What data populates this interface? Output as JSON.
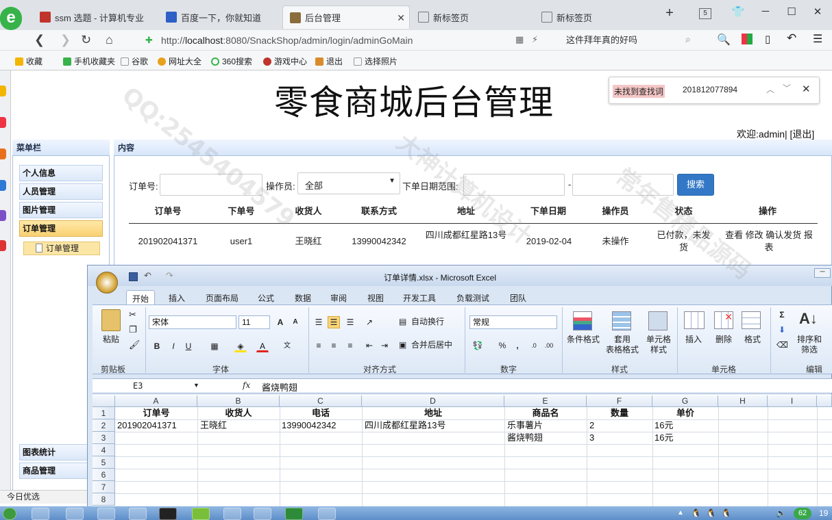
{
  "browser": {
    "tabs": [
      {
        "label": "ssm 选题 - 计算机专业",
        "color": "#c0342c"
      },
      {
        "label": "百度一下，你就知道",
        "color": "#2d5fc6"
      },
      {
        "label": "后台管理",
        "color": "#8a6d3b"
      },
      {
        "label": "新标签页",
        "color": "#777"
      },
      {
        "label": "新标签页",
        "color": "#777"
      }
    ],
    "tab_count": "5",
    "url_prefix": "http://",
    "url_domain": "localhost",
    "url_rest": ":8080/SnackShop/admin/login/adminGoMain",
    "search_text": "这件拜年真的好吗",
    "favorites": [
      "收藏",
      "手机收藏夹",
      "谷歌",
      "网址大全",
      "360搜索",
      "游戏中心",
      "退出",
      "选择照片"
    ]
  },
  "find": {
    "status": "未找到查找词",
    "query": "201812077894"
  },
  "page": {
    "title": "零食商城后台管理",
    "welcome": "欢迎:admin| [退出]",
    "menu_header": "菜单栏",
    "content_header": "内容",
    "menu": [
      "个人信息",
      "人员管理",
      "图片管理",
      "订单管理"
    ],
    "submenu": "订单管理",
    "menu_bottom": [
      "图表统计",
      "商品管理"
    ],
    "today": "今日优选"
  },
  "search_form": {
    "order_label": "订单号:",
    "operator_label": "操作员:",
    "operator_value": "全部",
    "date_label": "下单日期范围:",
    "date_sep": "-",
    "search_btn": "搜索"
  },
  "orders": {
    "headers": [
      "订单号",
      "下单号",
      "收货人",
      "联系方式",
      "地址",
      "下单日期",
      "操作员",
      "状态",
      "操作"
    ],
    "rows": [
      {
        "order_no": "201902041371",
        "user": "user1",
        "receiver": "王晓红",
        "phone": "13990042342",
        "address": "四川成都红星路13号",
        "date": "2019-02-04",
        "operator": "未操作",
        "status": "已付款，未发货",
        "actions": "查看 修改 确认发货 报表"
      }
    ]
  },
  "excel": {
    "title": "订单详情.xlsx - Microsoft Excel",
    "tabs": [
      "开始",
      "插入",
      "页面布局",
      "公式",
      "数据",
      "审阅",
      "视图",
      "开发工具",
      "负载测试",
      "团队"
    ],
    "groups": [
      "剪贴板",
      "字体",
      "对齐方式",
      "数字",
      "样式",
      "单元格",
      "编辑"
    ],
    "font": "宋体",
    "font_size": "11",
    "number_format": "常规",
    "buttons": {
      "paste": "粘贴",
      "wrap": "自动换行",
      "merge": "合并后居中",
      "cond_format": "条件格式",
      "table_format": "套用\n表格格式",
      "cell_style": "单元格\n样式",
      "insert": "插入",
      "delete": "删除",
      "format": "格式",
      "sort": "排序和\n筛选"
    },
    "cell_ref": "E3",
    "formula": "酱烧鸭翅",
    "columns": [
      "A",
      "B",
      "C",
      "D",
      "E",
      "F",
      "G",
      "H",
      "I"
    ],
    "row_numbers": [
      "1",
      "2",
      "3",
      "4",
      "5",
      "6",
      "7",
      "8"
    ],
    "header_row": [
      "订单号",
      "收货人",
      "电话",
      "地址",
      "商品名",
      "数量",
      "单价"
    ],
    "data_rows": [
      [
        "201902041371",
        "王晓红",
        "13990042342",
        "四川成都红星路13号",
        "乐事薯片",
        "2",
        "16元"
      ],
      [
        "",
        "",
        "",
        "",
        "酱烧鸭翅",
        "3",
        "16元"
      ]
    ]
  },
  "taskbar": {
    "badge": "62",
    "clock": "19"
  },
  "watermarks": [
    "QQ:2545404579",
    "大神计算机设计",
    "常年售精品源码"
  ]
}
